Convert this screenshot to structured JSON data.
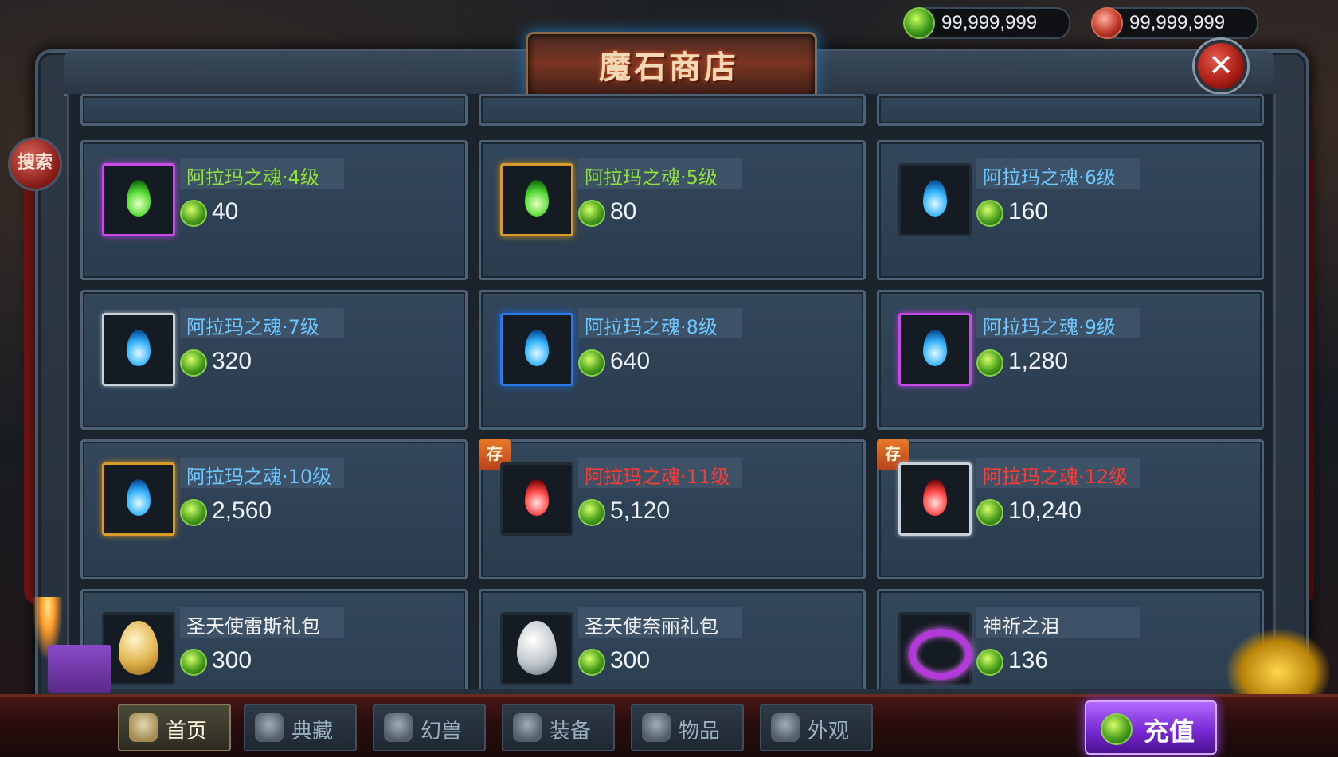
{
  "title": "魔石商店",
  "currency": [
    {
      "icon": "green-gem-icon",
      "value": "99,999,999"
    },
    {
      "icon": "gift-gem-icon",
      "value": "99,999,999"
    }
  ],
  "close_label": "✕",
  "search_label": "搜索",
  "badge_label": "存",
  "items": [
    {
      "name": "阿拉玛之魂·4级",
      "price": "40",
      "name_color": "green",
      "frame": "purple",
      "icon": "green-soul-flame-icon"
    },
    {
      "name": "阿拉玛之魂·5级",
      "price": "80",
      "name_color": "green",
      "frame": "gold",
      "icon": "green-soul-flame-icon"
    },
    {
      "name": "阿拉玛之魂·6级",
      "price": "160",
      "name_color": "blue",
      "frame": "dark",
      "icon": "blue-soul-flame-icon"
    },
    {
      "name": "阿拉玛之魂·7级",
      "price": "320",
      "name_color": "blue",
      "frame": "silver",
      "icon": "blue-soul-flame-icon"
    },
    {
      "name": "阿拉玛之魂·8级",
      "price": "640",
      "name_color": "blue",
      "frame": "blue",
      "icon": "blue-soul-flame-icon"
    },
    {
      "name": "阿拉玛之魂·9级",
      "price": "1,280",
      "name_color": "blue",
      "frame": "purple",
      "icon": "blue-soul-flame-icon"
    },
    {
      "name": "阿拉玛之魂·10级",
      "price": "2,560",
      "name_color": "blue",
      "frame": "gold",
      "icon": "blue-soul-flame-icon"
    },
    {
      "name": "阿拉玛之魂·11级",
      "price": "5,120",
      "name_color": "red",
      "frame": "dark",
      "icon": "red-soul-flame-icon",
      "badge": true
    },
    {
      "name": "阿拉玛之魂·12级",
      "price": "10,240",
      "name_color": "red",
      "frame": "silver",
      "icon": "red-soul-flame-icon",
      "badge": true
    },
    {
      "name": "圣天使雷斯礼包",
      "price": "300",
      "name_color": "white",
      "frame": "dark",
      "icon": "golden-egg-icon"
    },
    {
      "name": "圣天使奈丽礼包",
      "price": "300",
      "name_color": "white",
      "frame": "dark",
      "icon": "white-egg-icon"
    },
    {
      "name": "神祈之泪",
      "price": "136",
      "name_color": "white",
      "frame": "dark",
      "icon": "purple-ring-icon"
    }
  ],
  "tabs": [
    {
      "label": "首页",
      "icon": "compass-icon",
      "active": true
    },
    {
      "label": "典藏",
      "icon": "collection-icon",
      "active": false
    },
    {
      "label": "幻兽",
      "icon": "beast-icon",
      "active": false
    },
    {
      "label": "装备",
      "icon": "axe-icon",
      "active": false
    },
    {
      "label": "物品",
      "icon": "gift-box-icon",
      "active": false
    },
    {
      "label": "外观",
      "icon": "cloak-icon",
      "active": false
    }
  ],
  "recharge_label": "充值",
  "colors": {
    "accent_gold": "#d89a2a",
    "accent_purple": "#9a4af0",
    "price_green": "#4aa01c"
  }
}
